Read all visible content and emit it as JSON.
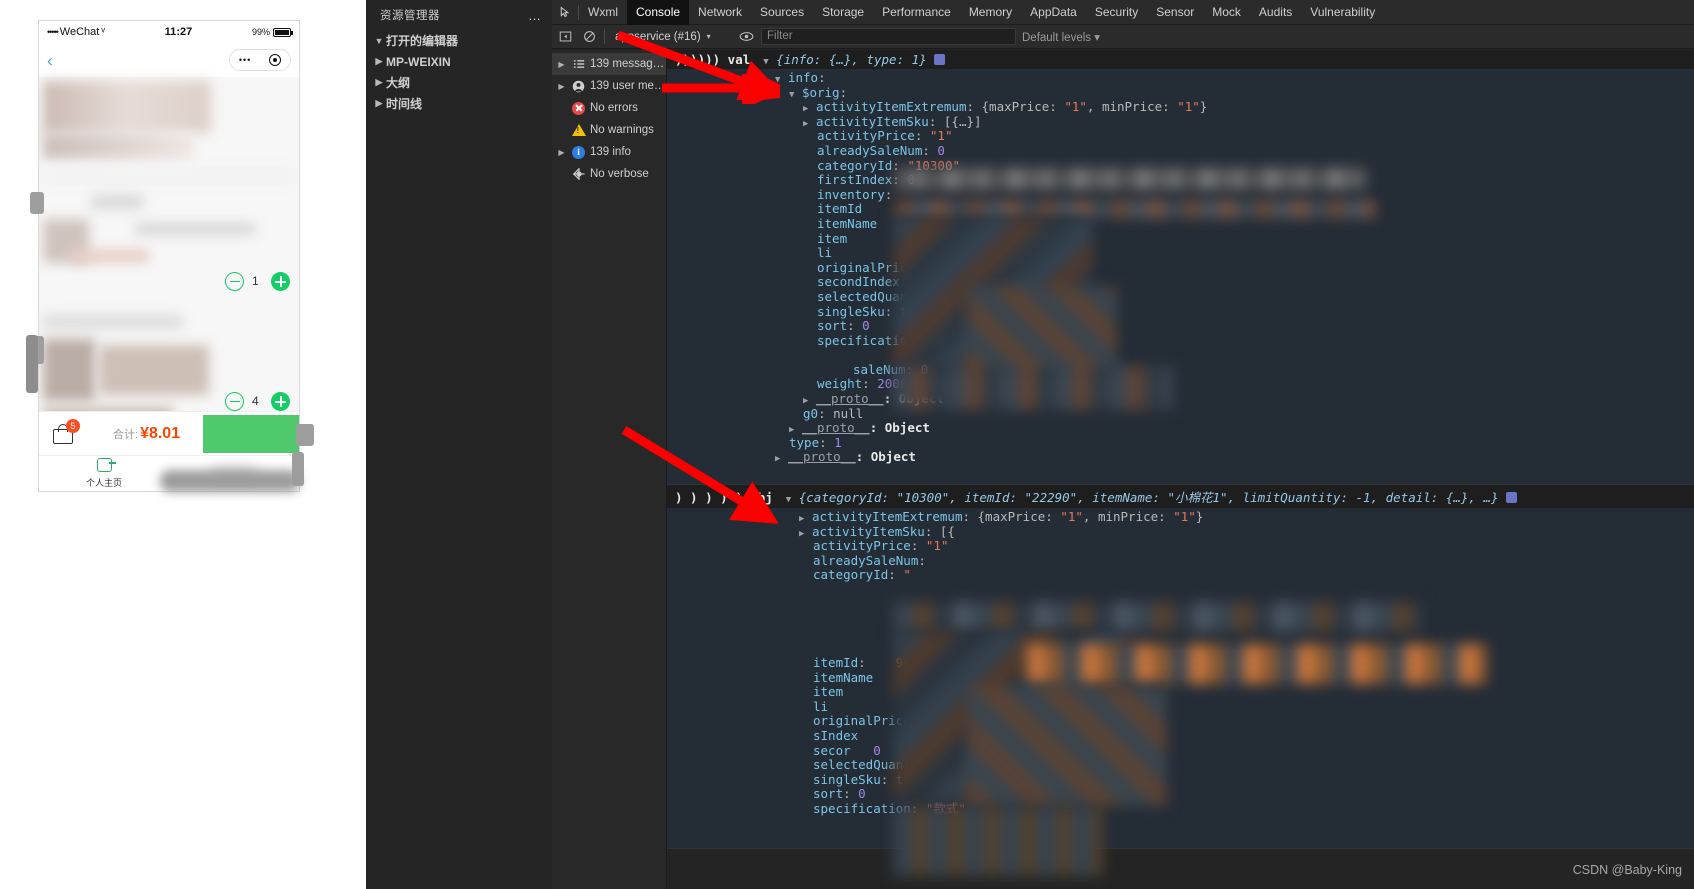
{
  "simulator": {
    "statusbar": {
      "carrier": "WeChat",
      "dots": "•••••",
      "wifi": "ᵛ",
      "time": "11:27",
      "battery": "99%"
    },
    "nav": {
      "back_icon": "chevron-left",
      "capsule_menu": "•••",
      "capsule_close": "target"
    },
    "cart": {
      "badge": "5",
      "total_label": "合计:",
      "total_value": "¥8.01",
      "buy_label": ""
    },
    "items": [
      {
        "qty": "1"
      },
      {
        "qty": "4"
      }
    ],
    "tabbar": [
      {
        "label": "个人主页",
        "icon": "user-home-icon"
      }
    ]
  },
  "explorer": {
    "title": "资源管理器",
    "more": "…",
    "items": [
      {
        "label": "打开的编辑器",
        "twisty": "▼"
      },
      {
        "label": "MP-WEIXIN",
        "twisty": "▶"
      },
      {
        "label": "大纲",
        "twisty": "▶"
      },
      {
        "label": "时间线",
        "twisty": "▶"
      }
    ]
  },
  "devtools": {
    "tabs": [
      {
        "label": "Wxml",
        "active": false
      },
      {
        "label": "Console",
        "active": true
      },
      {
        "label": "Network",
        "active": false
      },
      {
        "label": "Sources",
        "active": false
      },
      {
        "label": "Storage",
        "active": false
      },
      {
        "label": "Performance",
        "active": false
      },
      {
        "label": "Memory",
        "active": false
      },
      {
        "label": "AppData",
        "active": false
      },
      {
        "label": "Security",
        "active": false
      },
      {
        "label": "Sensor",
        "active": false
      },
      {
        "label": "Mock",
        "active": false
      },
      {
        "label": "Audits",
        "active": false
      },
      {
        "label": "Vulnerability",
        "active": false
      }
    ],
    "toolbar": {
      "sidebar_icon": "panel-toggle-icon",
      "clear_icon": "clear-console-icon",
      "context": "appservice (#16)",
      "context_caret": "▾",
      "eye_icon": "live-expression-icon",
      "filter_placeholder": "Filter",
      "filter_value": "",
      "levels": "Default levels",
      "levels_caret": "▾"
    },
    "sidebar": [
      {
        "label": "139 messag…",
        "icon": "list-icon",
        "twisty": "▶",
        "selected": true
      },
      {
        "label": "139 user me…",
        "icon": "user-icon",
        "twisty": "▶",
        "selected": false
      },
      {
        "label": "No errors",
        "icon": "error-icon",
        "twisty": "",
        "selected": false
      },
      {
        "label": "No warnings",
        "icon": "warning-icon",
        "twisty": "",
        "selected": false
      },
      {
        "label": "139 info",
        "icon": "info-icon",
        "twisty": "▶",
        "selected": false
      },
      {
        "label": "No verbose",
        "icon": "verbose-gear-icon",
        "twisty": "",
        "selected": false
      }
    ],
    "log1": {
      "prefix": ")))))) val",
      "summary": "{info: {…}, type: 1}",
      "badge": "info-badge",
      "lines": [
        "  ▼ info:",
        "    ▼ $orig:",
        "      ▶ activityItemExtremum: {maxPrice: \"1\", minPrice: \"1\"}",
        "      ▶ activityItemSku: [{…}]",
        "        activityPrice: \"1\"",
        "        alreadySaleNum: 0",
        "        categoryId: \"10300\"",
        "        firstIndex: 0",
        "        inventory:",
        "        itemId:",
        "        itemName:",
        "        item",
        "        li",
        "        originalPrice:",
        "        secondIndex:",
        "        selectedQuantity: 2",
        "        singleSku: true",
        "        sort: 0",
        "        specification:",
        "        saleNum: 0",
        "        weight: 2000",
        "      ▶ __proto__: Object",
        "      g0: null",
        "    ▶ __proto__: Object",
        "    type: 1",
        "  ▶ __proto__: Object"
      ]
    },
    "log2": {
      "prefix": ") ) ) ) ) obj",
      "summary": "{categoryId: \"10300\", itemId: \"22290\", itemName: \"小棉花1\", limitQuantity: -1, detail: {…}, …}",
      "badge": "info-badge",
      "lines": [
        "  ▶ activityItemExtremum: {maxPrice: \"1\", minPrice: \"1\"}",
        "  ▶ activityItemSku: [{",
        "    activityPrice: \"1\"",
        "    alreadySaleNum:",
        "    categoryId: \"",
        "    ",
        "    ",
        "    ",
        "    itemId:      90\"",
        "    itemName:",
        "    item",
        "    li",
        "    originalPrice:",
        "    sIndex:",
        "    secondIndex: 0",
        "    selectedQuantity: 2",
        "    singleSku: true",
        "    sort: 0",
        "    specification: \"款式\""
      ]
    }
  },
  "watermark": "CSDN @Baby-King",
  "colors": {
    "accent_green": "#13ce66",
    "price_orange": "#ff4400",
    "badge_red": "#ff4d22",
    "arrow_red": "#ff0000",
    "panel_bg": "#242424",
    "console_bg": "#242c36"
  }
}
